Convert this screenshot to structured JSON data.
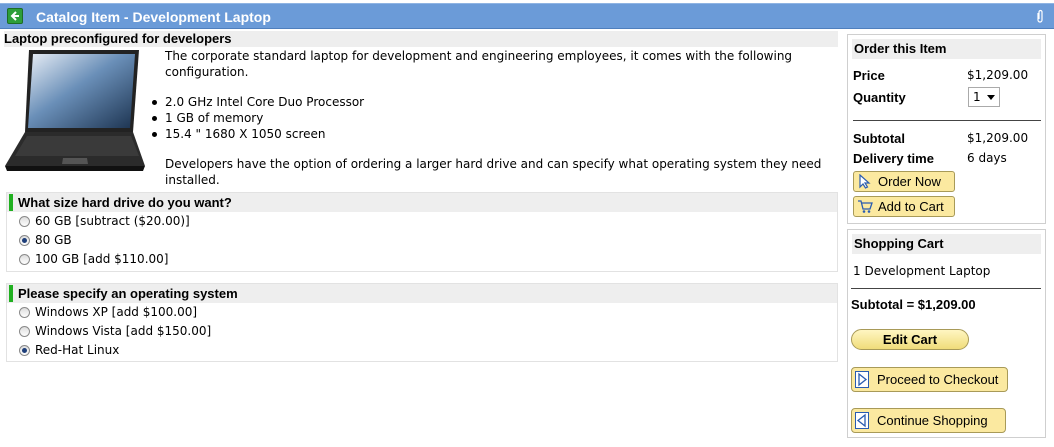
{
  "window": {
    "title": "Catalog Item - Development Laptop",
    "back_icon": "back-arrow-icon",
    "attach_icon": "paperclip-icon"
  },
  "item": {
    "heading": "Laptop preconfigured for developers",
    "image": "laptop-image",
    "intro": "The corporate standard laptop for development and engineering employees, it comes with the following configuration.",
    "specs": [
      "2.0 GHz Intel Core Duo Processor",
      "1 GB of memory",
      "15.4 \" 1680 X 1050 screen"
    ],
    "note": "Developers have the option of ordering a larger hard drive and can specify what operating system they need installed."
  },
  "questions": [
    {
      "label": "What size hard drive do you want?",
      "options": [
        {
          "label": "60 GB [subtract ($20.00)]",
          "selected": false
        },
        {
          "label": "80 GB",
          "selected": true
        },
        {
          "label": "100 GB [add $110.00]",
          "selected": false
        }
      ]
    },
    {
      "label": "Please specify an operating system",
      "options": [
        {
          "label": "Windows XP [add $100.00]",
          "selected": false
        },
        {
          "label": "Windows Vista [add $150.00]",
          "selected": false
        },
        {
          "label": "Red-Hat Linux",
          "selected": true
        }
      ]
    }
  ],
  "order": {
    "heading": "Order this Item",
    "price_label": "Price",
    "price_value": "$1,209.00",
    "quantity_label": "Quantity",
    "quantity_value": "1",
    "subtotal_label": "Subtotal",
    "subtotal_value": "$1,209.00",
    "delivery_label": "Delivery time",
    "delivery_value": "6 days",
    "order_now_label": "Order Now",
    "add_to_cart_label": "Add to Cart"
  },
  "cart": {
    "heading": "Shopping Cart",
    "item": "1 Development Laptop",
    "subtotal": "Subtotal = $1,209.00",
    "edit_label": "Edit Cart",
    "checkout_label": "Proceed to Checkout",
    "continue_label": "Continue Shopping"
  },
  "colors": {
    "titlebar": "#6b9bd8",
    "button_fill": "#fbe9a0",
    "question_marker": "#20b020"
  }
}
